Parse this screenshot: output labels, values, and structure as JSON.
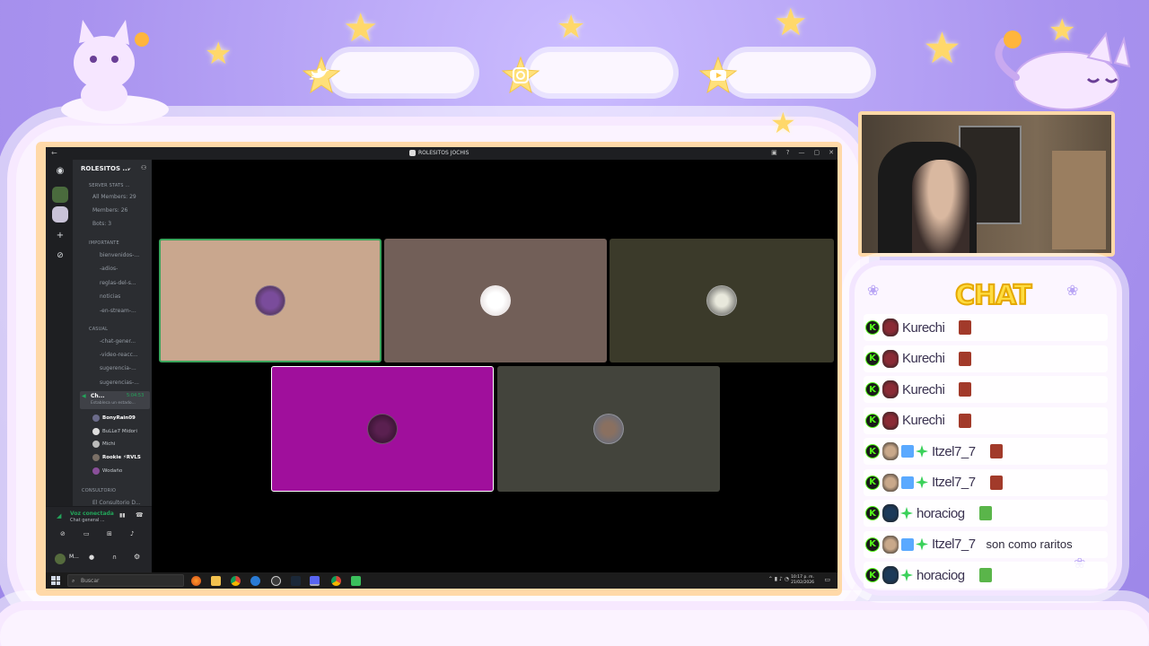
{
  "overlay": {
    "chat_title": "CHAT",
    "social_icons": [
      "twitter-icon",
      "instagram-icon",
      "youtube-icon"
    ]
  },
  "window": {
    "title": "ROLESITOS JOCHIS"
  },
  "server": {
    "name": "ROLESITOS ...",
    "categories": {
      "stats": "SERVER STATS ...",
      "importante": "IMPORTANTE",
      "casual": "CASUAL",
      "consultorio": "CONSULTORIO"
    },
    "stats": [
      "All Members: 29",
      "Members: 26",
      "Bots: 3"
    ],
    "important_channels": [
      "bienvenidos-...",
      "-adios-",
      "reglas-del-s...",
      "noticias",
      "-en-stream-..."
    ],
    "casual_channels": [
      "-chat-gener...",
      "-video-reacc...",
      "sugerencia-...",
      "sugerencias-..."
    ],
    "active_voice": {
      "name": "Ch...",
      "timer": "5:04:53",
      "status": "Estableca un estado..."
    },
    "voice_users": [
      "BonyRain09",
      "BuLLe7 Midori",
      "Michi",
      "Rookie ⚡RVLS",
      "Wodaño"
    ],
    "consultorio_channel": "El Consultorio D..."
  },
  "voice_panel": {
    "status": "Voz conectada",
    "channel": "Chat general ..."
  },
  "user_panel": {
    "name": "M..."
  },
  "taskbar": {
    "search_placeholder": "Buscar",
    "time": "10:17 p. m.",
    "date": "21/02/2026"
  },
  "video_tiles": [
    {
      "bg": "#c9a78e",
      "avatar": "#6c3f86",
      "speaking": true
    },
    {
      "bg": "#725f58",
      "avatar": "#f0eaea",
      "speaking": false
    },
    {
      "bg": "#3b3a2a",
      "avatar": "#d8d8c8",
      "speaking": false
    },
    {
      "bg": "#a00f9c",
      "avatar": "#3a1430",
      "speaking": false
    },
    {
      "bg": "#43443c",
      "avatar": "#6a7890",
      "speaking": false
    }
  ],
  "chat": [
    {
      "user": "Kurechi",
      "message": "",
      "emote": true,
      "badges": 0
    },
    {
      "user": "Kurechi",
      "message": "",
      "emote": true,
      "badges": 0
    },
    {
      "user": "Kurechi",
      "message": "",
      "emote": true,
      "badges": 0
    },
    {
      "user": "Kurechi",
      "message": "",
      "emote": true,
      "badges": 0
    },
    {
      "user": "Itzel7_7",
      "message": "",
      "emote": true,
      "badges": 2
    },
    {
      "user": "Itzel7_7",
      "message": "",
      "emote": true,
      "badges": 2
    },
    {
      "user": "horaciog",
      "message": "",
      "emote": true,
      "badges": 1
    },
    {
      "user": "Itzel7_7",
      "message": "son como raritos",
      "emote": false,
      "badges": 2
    },
    {
      "user": "horaciog",
      "message": "",
      "emote": true,
      "badges": 1
    }
  ],
  "colors": {
    "accent": "#53fc18",
    "chat_title": "#ffdc40",
    "overlay_bg": "#a993ef"
  }
}
